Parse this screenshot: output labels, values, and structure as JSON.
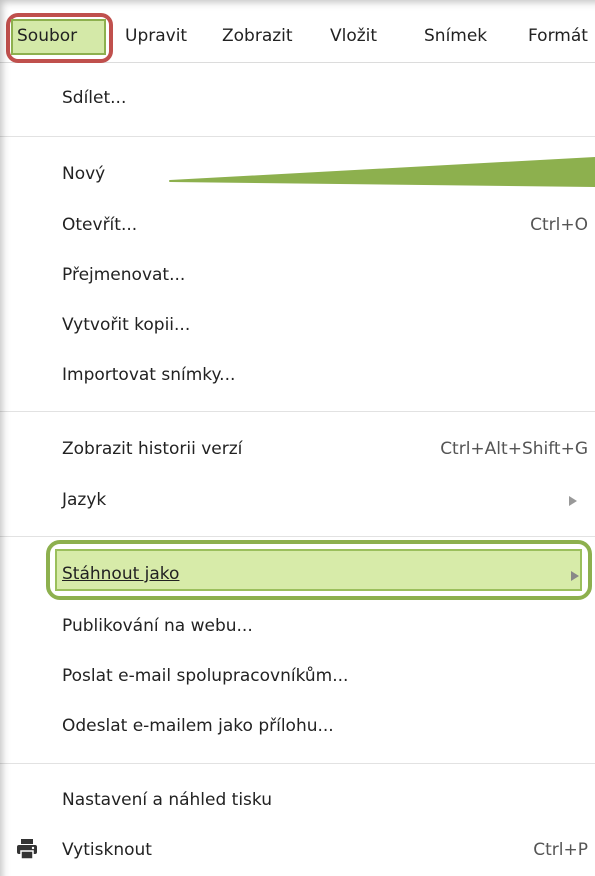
{
  "menubar": {
    "items": [
      "Soubor",
      "Upravit",
      "Zobrazit",
      "Vložit",
      "Snímek",
      "Formát"
    ]
  },
  "menu": {
    "share": "Sdílet...",
    "new": "Nový",
    "open": "Otevřít...",
    "open_shortcut": "Ctrl+O",
    "rename": "Přejmenovat...",
    "copy": "Vytvořit kopii...",
    "import": "Importovat snímky...",
    "history": "Zobrazit historii verzí",
    "history_shortcut": "Ctrl+Alt+Shift+G",
    "language": "Jazyk",
    "download": "Stáhnout jako",
    "publish": "Publikování na webu...",
    "email_collaborators": "Poslat e-mail spolupracovníkům...",
    "email_attachment": "Odeslat e-mailem jako přílohu...",
    "print_settings": "Nastavení a náhled tisku",
    "print": "Vytisknout",
    "print_shortcut": "Ctrl+P"
  },
  "colors": {
    "red_highlight": "#c0504d",
    "green_highlight": "#8db04e",
    "green_fill": "#d7eba9"
  },
  "icons": {
    "print": "printer-icon",
    "submenu": "submenu-arrow-icon"
  }
}
